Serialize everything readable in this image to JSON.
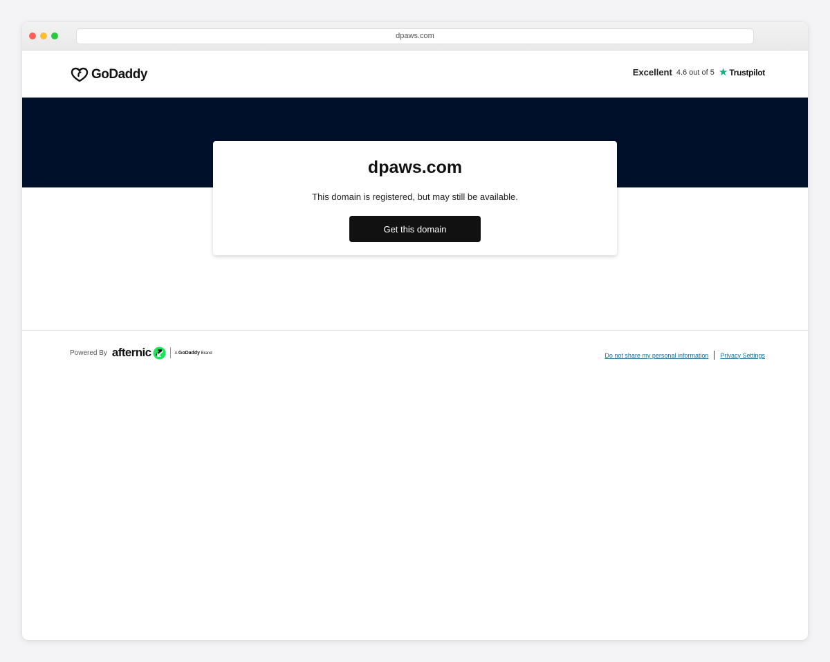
{
  "browser": {
    "url": "dpaws.com"
  },
  "header": {
    "logo_text": "GoDaddy",
    "trustpilot": {
      "rating_word": "Excellent",
      "score": "4.6 out of 5",
      "brand": "Trustpilot",
      "star_color": "#00b67a"
    }
  },
  "hero": {
    "background_color": "#00102a"
  },
  "card": {
    "domain": "dpaws.com",
    "subtitle": "This domain is registered, but may still be available.",
    "cta_label": "Get this domain"
  },
  "footer": {
    "powered_by": "Powered By",
    "afternic": "afternic",
    "brand_tag_prefix": "A",
    "brand_tag_name": "GoDaddy",
    "brand_tag_suffix": "Brand",
    "links": [
      "Do not share my personal information",
      "Privacy Settings"
    ],
    "accent_color": "#1a6e8c"
  }
}
